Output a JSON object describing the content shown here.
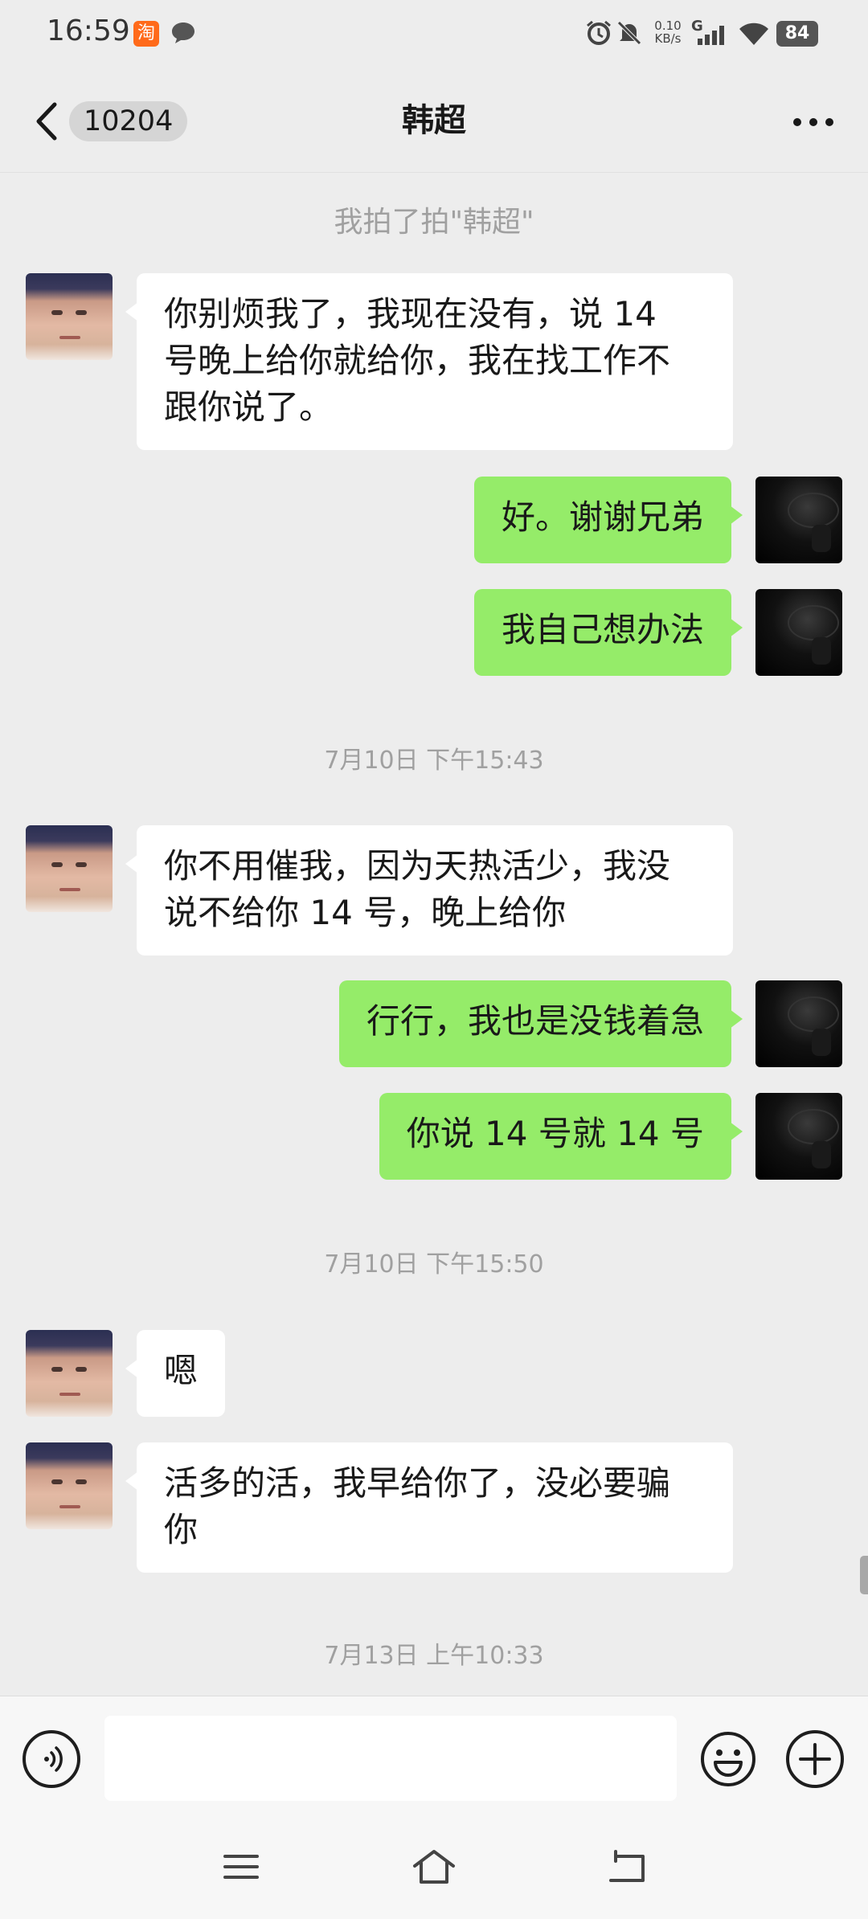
{
  "status_bar": {
    "time": "16:59",
    "taobao_glyph": "淘",
    "net_speed_value": "0.10",
    "net_speed_unit": "KB/s",
    "network_type": "G",
    "battery": "84",
    "icons": [
      "taobao-icon",
      "chat-notification-icon",
      "alarm-icon",
      "mute-icon",
      "signal-icon",
      "wifi-icon",
      "battery-icon"
    ]
  },
  "header": {
    "back_icon": "chevron-left-icon",
    "unread_count": "10204",
    "title": "韩超",
    "more_icon": "more-dots-icon"
  },
  "messages": [
    {
      "type": "system",
      "text": "我拍了拍\"韩超\""
    },
    {
      "type": "received",
      "lines": [
        "你别烦我了，我现在没有，说 14",
        "号晚上给你就给你，我在找工作不",
        "跟你说了。"
      ]
    },
    {
      "type": "sent",
      "text": "好。谢谢兄弟"
    },
    {
      "type": "sent",
      "text": "我自己想办法"
    },
    {
      "type": "timestamp",
      "text": "7月10日 下午15:43"
    },
    {
      "type": "received",
      "lines": [
        "你不用催我，因为天热活少，我没",
        "说不给你 14 号，晚上给你"
      ]
    },
    {
      "type": "sent",
      "text": "行行，我也是没钱着急"
    },
    {
      "type": "sent",
      "text": "你说 14 号就 14 号"
    },
    {
      "type": "timestamp",
      "text": "7月10日 下午15:50"
    },
    {
      "type": "received",
      "lines": [
        "嗯"
      ]
    },
    {
      "type": "received",
      "lines": [
        "活多的活，我早给你了，没必要骗",
        "你"
      ]
    },
    {
      "type": "timestamp",
      "text": "7月13日 上午10:33"
    }
  ],
  "input_bar": {
    "voice_icon": "voice-icon",
    "message_value": "",
    "emoji_icon": "emoji-icon",
    "plus_icon": "plus-icon"
  },
  "system_nav": {
    "icons": [
      "menu-icon",
      "home-icon",
      "back-icon"
    ]
  },
  "colors": {
    "background": "#EDEDED",
    "sent_bubble": "#95EC69",
    "received_bubble": "#FFFFFF",
    "timestamp_text": "#A0A0A0"
  }
}
